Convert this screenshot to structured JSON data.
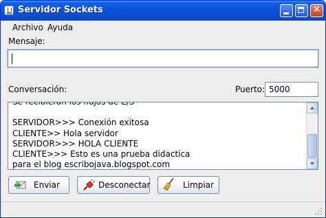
{
  "window": {
    "title": "Servidor Sockets",
    "close_glyph": "✕"
  },
  "menu": {
    "items": [
      {
        "label": "Archivo"
      },
      {
        "label": "Ayuda"
      }
    ]
  },
  "form": {
    "mensaje_label": "Mensaje:",
    "mensaje_value": "",
    "conversacion_label": "Conversación:",
    "puerto_label": "Puerto:",
    "puerto_value": "5000"
  },
  "conversation": {
    "lines": [
      "Se recibieron los flujos de E/S",
      "",
      "SERVIDOR>>> Conexión exitosa",
      "CLIENTE>> Hola servidor",
      "SERVIDOR>>> HOLA CLIENTE",
      "CLIENTE>>> Esto es una prueba didactica",
      "para el blog escribojava.blogspot.com"
    ]
  },
  "buttons": {
    "enviar": "Enviar",
    "desconectar": "Desconectar",
    "limpiar": "Limpiar"
  },
  "icons": {
    "app": "java-cup-icon",
    "enviar": "send-mail-icon",
    "desconectar": "plug-icon",
    "limpiar": "broom-icon"
  }
}
